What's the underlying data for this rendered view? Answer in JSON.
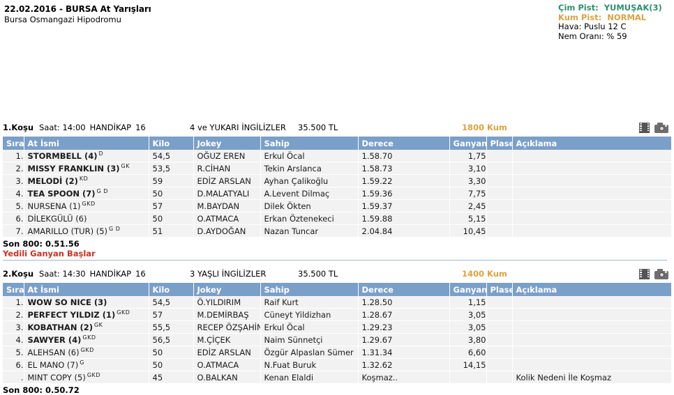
{
  "header": {
    "title": "22.02.2016 - BURSA At Yarışları",
    "venue": "Bursa Osmangazi Hipodromu",
    "track_info": {
      "cim_label": "Çim Pist:",
      "cim_value": "YUMUŞAK(3)",
      "kum_label": "Kum Pist:",
      "kum_value": "NORMAL",
      "hava": "Hava: Puslu 12 C",
      "nem": "Nem Oranı: % 59",
      "cim_color": "#2f8f6e",
      "kum_color": "#d9a441"
    }
  },
  "columns": {
    "sira": "Sıra",
    "at_ismi": "At İsmi",
    "kilo": "Kilo",
    "jokey": "Jokey",
    "sahip": "Sahip",
    "derece": "Derece",
    "ganyan": "Ganyan",
    "plase": "Plase",
    "aciklama": "Açıklama"
  },
  "races": [
    {
      "no": "1.Koşu",
      "saat": "Saat: 14:00",
      "tur": "HANDİKAP",
      "tur_no": "16",
      "conditions": "4 ve YUKARI İNGİLİZLER",
      "prize": "35.500 TL",
      "distance": "1800 Kum",
      "icons": [
        "film-icon",
        "camera-icon"
      ],
      "rows": [
        {
          "sira": "1.",
          "horse": "STORMBELL (4)",
          "eq": "D",
          "bold": true,
          "kilo": "54,5",
          "jokey": "OĞUZ EREN",
          "sahip": "Erkul Öcal",
          "derece": "1.58.70",
          "ganyan": "1,75",
          "plase": "",
          "aciklama": ""
        },
        {
          "sira": "2.",
          "horse": "MISSY FRANKLIN (3)",
          "eq": "GK",
          "bold": true,
          "kilo": "53,5",
          "jokey": "R.CİHAN",
          "sahip": "Tekin Arslanca",
          "derece": "1.58.73",
          "ganyan": "3,10",
          "plase": "",
          "aciklama": ""
        },
        {
          "sira": "3.",
          "horse": "MELODİ (2)",
          "eq": "KD",
          "bold": true,
          "kilo": "59",
          "jokey": "EDİZ ARSLAN",
          "sahip": "Ayhan Çalikoğlu",
          "derece": "1.59.22",
          "ganyan": "3,30",
          "plase": "",
          "aciklama": ""
        },
        {
          "sira": "4.",
          "horse": "TEA SPOON (7)",
          "eq": "G D",
          "bold": true,
          "kilo": "50",
          "jokey": "D.MALATYALI",
          "sahip": "A.Levent Dilmaç",
          "derece": "1.59.36",
          "ganyan": "7,75",
          "plase": "",
          "aciklama": ""
        },
        {
          "sira": "5.",
          "horse": "NURSENA (1)",
          "eq": "GKD",
          "bold": false,
          "kilo": "57",
          "jokey": "M.BAYDAN",
          "sahip": "Dilek Ökten",
          "derece": "1.59.37",
          "ganyan": "2,45",
          "plase": "",
          "aciklama": ""
        },
        {
          "sira": "6.",
          "horse": "DİLEKGÜLÜ (6)",
          "eq": "",
          "bold": false,
          "kilo": "50",
          "jokey": "O.ATMACA",
          "sahip": "Erkan Öztenekeci",
          "derece": "1.59.88",
          "ganyan": "5,15",
          "plase": "",
          "aciklama": ""
        },
        {
          "sira": "7.",
          "horse": "AMARILLO (TUR) (5)",
          "eq": "G D",
          "bold": false,
          "kilo": "51",
          "jokey": "D.AYDOĞAN",
          "sahip": "Nazan Tuncar",
          "derece": "2.04.84",
          "ganyan": "10,45",
          "plase": "",
          "aciklama": ""
        }
      ],
      "son800": "Son 800: 0.51.56",
      "note": "Yedili Ganyan Başlar",
      "note_color": "#cc3322"
    },
    {
      "no": "2.Koşu",
      "saat": "Saat: 14:30",
      "tur": "HANDİKAP",
      "tur_no": "16",
      "conditions": "3 YAŞLI İNGİLİZLER",
      "prize": "35.500 TL",
      "distance": "1400 Kum",
      "icons": [
        "film-icon",
        "camera-icon"
      ],
      "rows": [
        {
          "sira": "1.",
          "horse": "WOW SO NICE (3)",
          "eq": "",
          "bold": true,
          "kilo": "54,5",
          "jokey": "Ö.YILDIRIM",
          "sahip": "Raif Kurt",
          "derece": "1.28.50",
          "ganyan": "1,15",
          "plase": "",
          "aciklama": ""
        },
        {
          "sira": "2.",
          "horse": "PERFECT YILDIZ (1)",
          "eq": "GKD",
          "bold": true,
          "kilo": "57",
          "jokey": "M.DEMİRBAŞ",
          "sahip": "Cüneyt Yildizhan",
          "derece": "1.28.67",
          "ganyan": "3,05",
          "plase": "",
          "aciklama": ""
        },
        {
          "sira": "3.",
          "horse": "KOBATHAN (2)",
          "eq": "GK",
          "bold": true,
          "kilo": "55,5",
          "jokey": "RECEP ÖZŞAHİN",
          "sahip": "Erkul Öcal",
          "derece": "1.29.23",
          "ganyan": "3,05",
          "plase": "",
          "aciklama": ""
        },
        {
          "sira": "4.",
          "horse": "SAWYER (4)",
          "eq": "GKD",
          "bold": true,
          "kilo": "56,5",
          "jokey": "M.ÇİÇEK",
          "sahip": "Naim Sünnetçi",
          "derece": "1.29.67",
          "ganyan": "3,80",
          "plase": "",
          "aciklama": ""
        },
        {
          "sira": "5.",
          "horse": "ALEHSAN (6)",
          "eq": "GKD",
          "bold": false,
          "kilo": "50",
          "jokey": "EDİZ ARSLAN",
          "sahip": "Özgür Alpaslan Sümer",
          "derece": "1.31.34",
          "ganyan": "6,60",
          "plase": "",
          "aciklama": ""
        },
        {
          "sira": "6.",
          "horse": "EL MANO (7)",
          "eq": "G",
          "bold": false,
          "kilo": "50",
          "jokey": "O.ATMACA",
          "sahip": "N.Fuat Buruk",
          "derece": "1.32.62",
          "ganyan": "14,15",
          "plase": "",
          "aciklama": ""
        },
        {
          "sira": ".",
          "horse": "MINT COPY (5)",
          "eq": "GKD",
          "bold": false,
          "kilo": "45",
          "jokey": "O.BALKAN",
          "sahip": "Kenan Elaldi",
          "derece": "Koşmaz..",
          "ganyan": "",
          "plase": "",
          "aciklama": "Kolik Nedeni İle Koşmaz"
        }
      ],
      "son800": "Son 800: 0.50.72",
      "note": "",
      "note_color": "#cc3322"
    }
  ]
}
